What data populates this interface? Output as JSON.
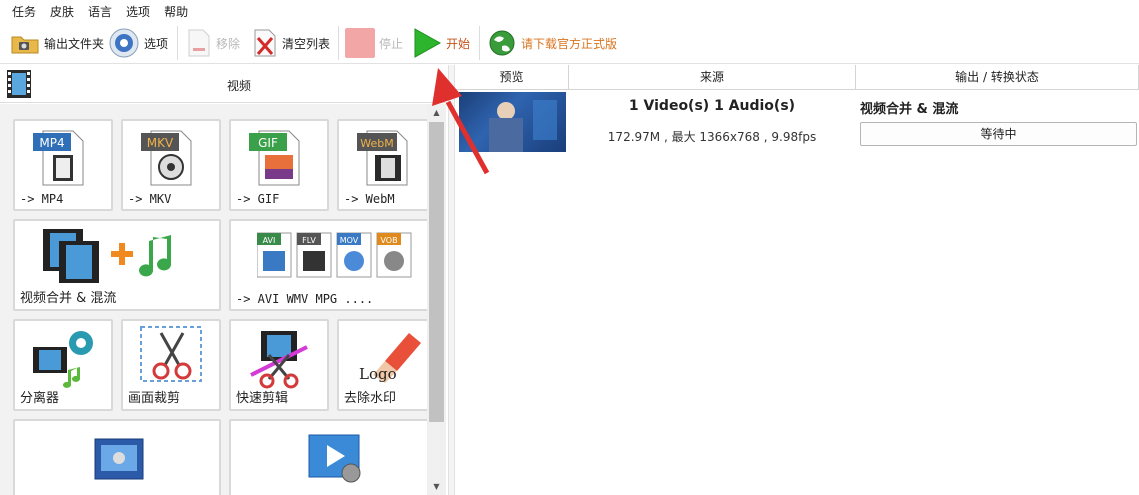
{
  "menu": [
    "任务",
    "皮肤",
    "语言",
    "选项",
    "帮助"
  ],
  "toolbar": {
    "output_folder": "输出文件夹",
    "options": "选项",
    "remove": "移除",
    "clear_list": "清空列表",
    "stop": "停止",
    "start": "开始",
    "download_official": "请下载官方正式版"
  },
  "left_panel": {
    "title": "视频",
    "tiles": {
      "mp4": {
        "badge": "MP4",
        "label": "-> MP4"
      },
      "mkv": {
        "badge": "MKV",
        "label": "-> MKV"
      },
      "gif": {
        "badge": "GIF",
        "label": "-> GIF"
      },
      "webm": {
        "badge": "WebM",
        "label": "-> WebM"
      },
      "merge": {
        "label": "视频合并 & 混流"
      },
      "multi": {
        "label": "-> AVI WMV MPG ....",
        "badges": [
          "AVI",
          "FLV",
          "MOV",
          "VOB"
        ]
      },
      "splitter": {
        "label": "分离器"
      },
      "crop": {
        "label": "画面裁剪"
      },
      "quick_cut": {
        "label": "快速剪辑"
      },
      "remove_watermark": {
        "label": "去除水印",
        "logo_text": "Logo"
      }
    }
  },
  "right_panel": {
    "columns": [
      "预览",
      "来源",
      "输出 / 转换状态"
    ],
    "task": {
      "source_title": "1 Video(s) 1 Audio(s)",
      "source_info": "172.97M , 最大 1366x768 , 9.98fps",
      "output_title": "视频合并 & 混流",
      "status": "等待中"
    }
  },
  "colors": {
    "start_green": "#2db52d",
    "stop_pink": "#f2a6a6",
    "annotation_red": "#e0302e",
    "download_orange": "#d9741f"
  }
}
